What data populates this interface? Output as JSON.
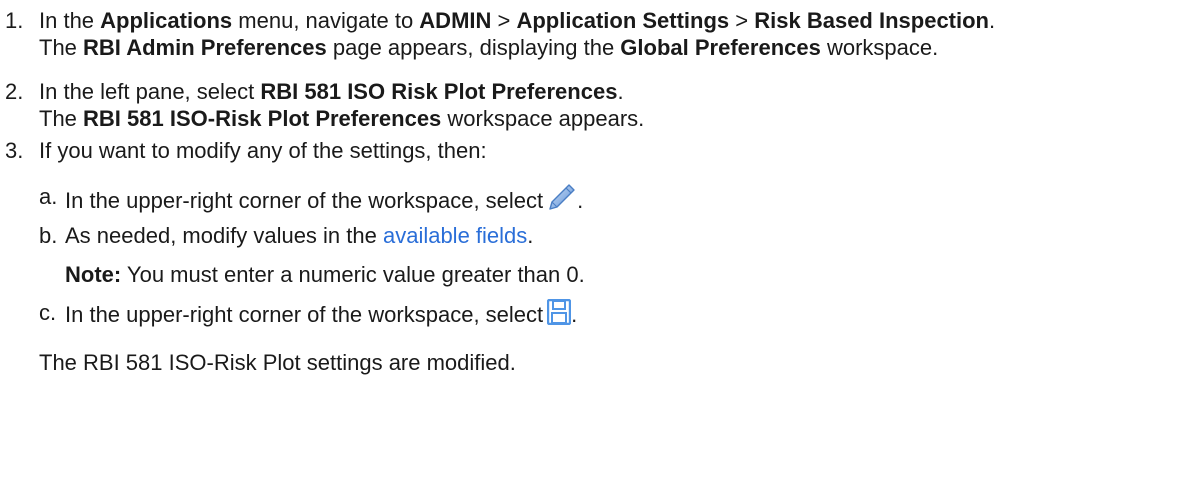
{
  "steps": [
    {
      "number": "1.",
      "parts": [
        "In the ",
        "Applications",
        " menu, navigate to ",
        "ADMIN",
        " > ",
        "Application Settings",
        " > ",
        "Risk Based Inspection",
        "."
      ],
      "result_parts": [
        "The ",
        "RBI Admin Preferences",
        " page appears, displaying the ",
        "Global Preferences",
        " workspace."
      ]
    },
    {
      "number": "2.",
      "parts": [
        "In the left pane, select ",
        "RBI 581 ISO Risk Plot Preferences",
        "."
      ],
      "result_parts": [
        "The ",
        "RBI 581 ISO-Risk Plot Preferences",
        " workspace appears."
      ]
    },
    {
      "number": "3.",
      "text": "If you want to modify any of the settings, then:",
      "substeps": [
        {
          "letter": "a.",
          "text": "In the upper-right corner of the workspace, select",
          "after": ".",
          "icon": "pencil-icon"
        },
        {
          "letter": "b.",
          "text": "As needed, modify values in the ",
          "link": "available fields",
          "after": "."
        },
        {
          "letter": "c.",
          "text": "In the upper-right corner of the workspace, select",
          "after": ".",
          "icon": "save-icon"
        }
      ],
      "note": {
        "label": "Note:",
        "text": " You must enter a numeric value greater than 0."
      }
    }
  ],
  "result": "The RBI 581 ISO-Risk Plot settings are modified.",
  "colors": {
    "link": "#2a6ed8",
    "pencil": "#5a8fd6",
    "save": "#4f95e6"
  }
}
